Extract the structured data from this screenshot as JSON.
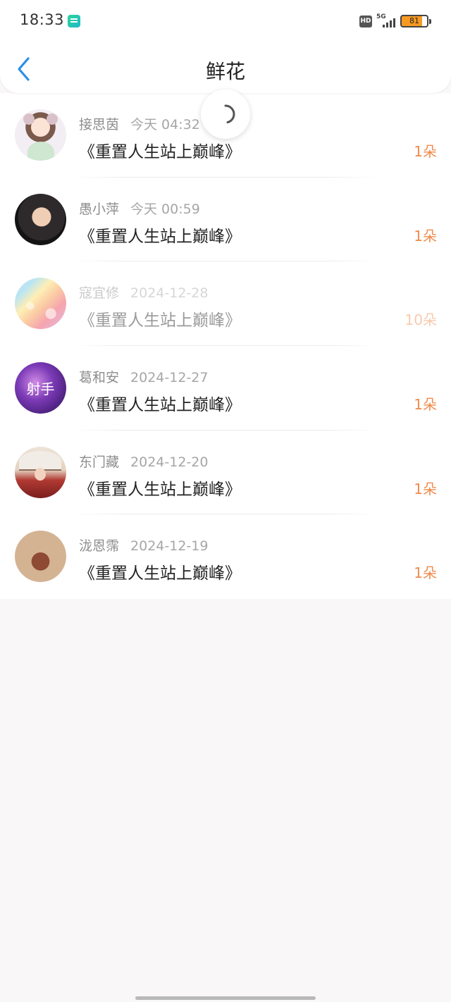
{
  "status_bar": {
    "time": "18:33",
    "network_type": "5G",
    "hd_label": "HD",
    "battery_level": "81"
  },
  "nav": {
    "title": "鲜花",
    "back_icon": "chevron-left-icon"
  },
  "list": [
    {
      "user": "接思茵",
      "date": "今天 04:32",
      "book": "《重置人生站上巅峰》",
      "count": "1朵",
      "faded": false
    },
    {
      "user": "愚小萍",
      "date": "今天 00:59",
      "book": "《重置人生站上巅峰》",
      "count": "1朵",
      "faded": false
    },
    {
      "user": "寇宜修",
      "date": "2024-12-28",
      "book": "《重置人生站上巅峰》",
      "count": "10朵",
      "faded": true
    },
    {
      "user": "葛和安",
      "date": "2024-12-27",
      "book": "《重置人生站上巅峰》",
      "count": "1朵",
      "faded": false,
      "avatar_text": "射手"
    },
    {
      "user": "东门藏",
      "date": "2024-12-20",
      "book": "《重置人生站上巅峰》",
      "count": "1朵",
      "faded": false
    },
    {
      "user": "泷恩霈",
      "date": "2024-12-19",
      "book": "《重置人生站上巅峰》",
      "count": "1朵",
      "faded": false
    }
  ],
  "colors": {
    "accent": "#2a8fe8",
    "count": "#f08a4b",
    "background": "#f9f7f7"
  }
}
